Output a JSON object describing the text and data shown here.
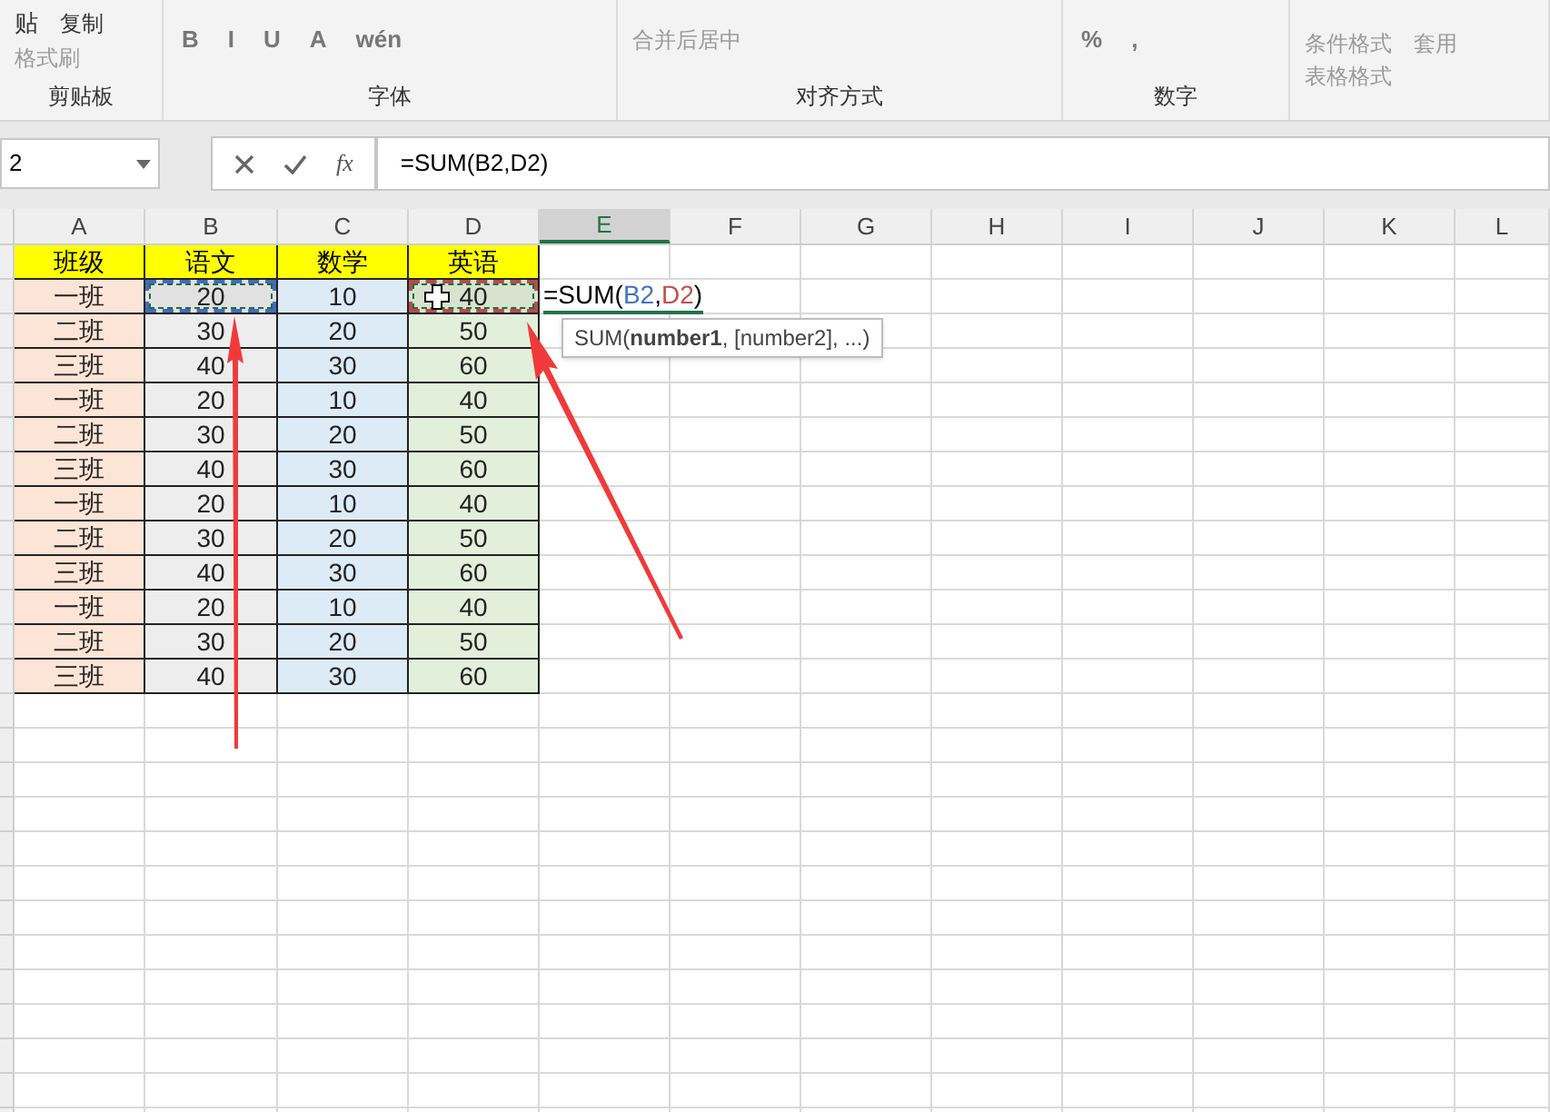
{
  "ribbon": {
    "groups": [
      {
        "label": "剪贴板",
        "items": [
          {
            "kind": "big",
            "text": "贴"
          },
          {
            "kind": "small",
            "text": "复制",
            "disabled": false
          },
          {
            "kind": "small",
            "text": "格式刷",
            "disabled": true
          }
        ]
      },
      {
        "label": "字体",
        "items": [
          {
            "kind": "font",
            "text": "B"
          },
          {
            "kind": "font",
            "text": "I"
          },
          {
            "kind": "font",
            "text": "U"
          },
          {
            "kind": "font",
            "text": "A"
          },
          {
            "kind": "font",
            "text": "wén"
          }
        ]
      },
      {
        "label": "对齐方式",
        "items": [
          {
            "kind": "small",
            "text": "合并后居中",
            "disabled": true
          }
        ]
      },
      {
        "label": "数字",
        "items": [
          {
            "kind": "font",
            "text": "%"
          },
          {
            "kind": "font",
            "text": ","
          }
        ]
      },
      {
        "items": [
          {
            "kind": "small",
            "text": "条件格式",
            "disabled": true
          },
          {
            "kind": "small",
            "text": "套用",
            "disabled": true
          },
          {
            "kind": "small",
            "text": "表格格式",
            "disabled": true
          }
        ]
      }
    ]
  },
  "name_box": "2",
  "formula_bar": {
    "fx": "fx",
    "value": "=SUM(B2,D2)"
  },
  "columns": [
    {
      "label": "A",
      "selected": false
    },
    {
      "label": "B",
      "selected": false
    },
    {
      "label": "C",
      "selected": false
    },
    {
      "label": "D",
      "selected": false
    },
    {
      "label": "E",
      "selected": true
    },
    {
      "label": "F",
      "selected": false
    },
    {
      "label": "G",
      "selected": false
    },
    {
      "label": "H",
      "selected": false
    },
    {
      "label": "I",
      "selected": false
    },
    {
      "label": "J",
      "selected": false
    },
    {
      "label": "K",
      "selected": false
    },
    {
      "label": "L",
      "selected": false
    }
  ],
  "table": {
    "header": [
      "班级",
      "语文",
      "数学",
      "英语"
    ],
    "rows": [
      {
        "cells": [
          {
            "text": "一班"
          },
          {
            "text": "20",
            "color": "#4472c4"
          },
          {
            "text": "10"
          },
          {
            "text": "40",
            "color": "#c0504d"
          }
        ],
        "editing": {
          "parts": [
            {
              "text": "=SUM(",
              "color": "#000000"
            },
            {
              "text": "B2",
              "color": "#4472c4"
            },
            {
              "text": ",",
              "color": "#000000"
            },
            {
              "text": "D2",
              "color": "#c0504d"
            },
            {
              "text": ")",
              "color": "#000000"
            }
          ],
          "tooltip": "SUM(**number1**, [number2], ...)"
        }
      },
      {
        "cells": [
          {
            "text": "二班"
          },
          {
            "text": "30"
          },
          {
            "text": "20"
          },
          {
            "text": "50"
          }
        ]
      },
      {
        "cells": [
          {
            "text": "三班"
          },
          {
            "text": "40"
          },
          {
            "text": "30"
          },
          {
            "text": "60"
          }
        ]
      },
      {
        "cells": [
          {
            "text": "一班"
          },
          {
            "text": "20"
          },
          {
            "text": "10"
          },
          {
            "text": "40"
          }
        ]
      },
      {
        "cells": [
          {
            "text": "二班"
          },
          {
            "text": "30"
          },
          {
            "text": "20"
          },
          {
            "text": "50"
          }
        ]
      },
      {
        "cells": [
          {
            "text": "三班"
          },
          {
            "text": "40"
          },
          {
            "text": "30"
          },
          {
            "text": "60"
          }
        ]
      },
      {
        "cells": [
          {
            "text": "一班"
          },
          {
            "text": "20"
          },
          {
            "text": "10"
          },
          {
            "text": "40"
          }
        ]
      },
      {
        "cells": [
          {
            "text": "二班"
          },
          {
            "text": "30"
          },
          {
            "text": "20"
          },
          {
            "text": "50"
          }
        ]
      },
      {
        "cells": [
          {
            "text": "三班"
          },
          {
            "text": "40"
          },
          {
            "text": "30"
          },
          {
            "text": "60"
          }
        ]
      },
      {
        "cells": [
          {
            "text": "一班"
          },
          {
            "text": "20"
          },
          {
            "text": "10"
          },
          {
            "text": "40"
          }
        ]
      },
      {
        "cells": [
          {
            "text": "二班"
          },
          {
            "text": "30"
          },
          {
            "text": "20"
          },
          {
            "text": "50"
          }
        ]
      },
      {
        "cells": [
          {
            "text": "三班"
          },
          {
            "text": "40"
          },
          {
            "text": "30"
          },
          {
            "text": "60"
          }
        ]
      }
    ]
  }
}
